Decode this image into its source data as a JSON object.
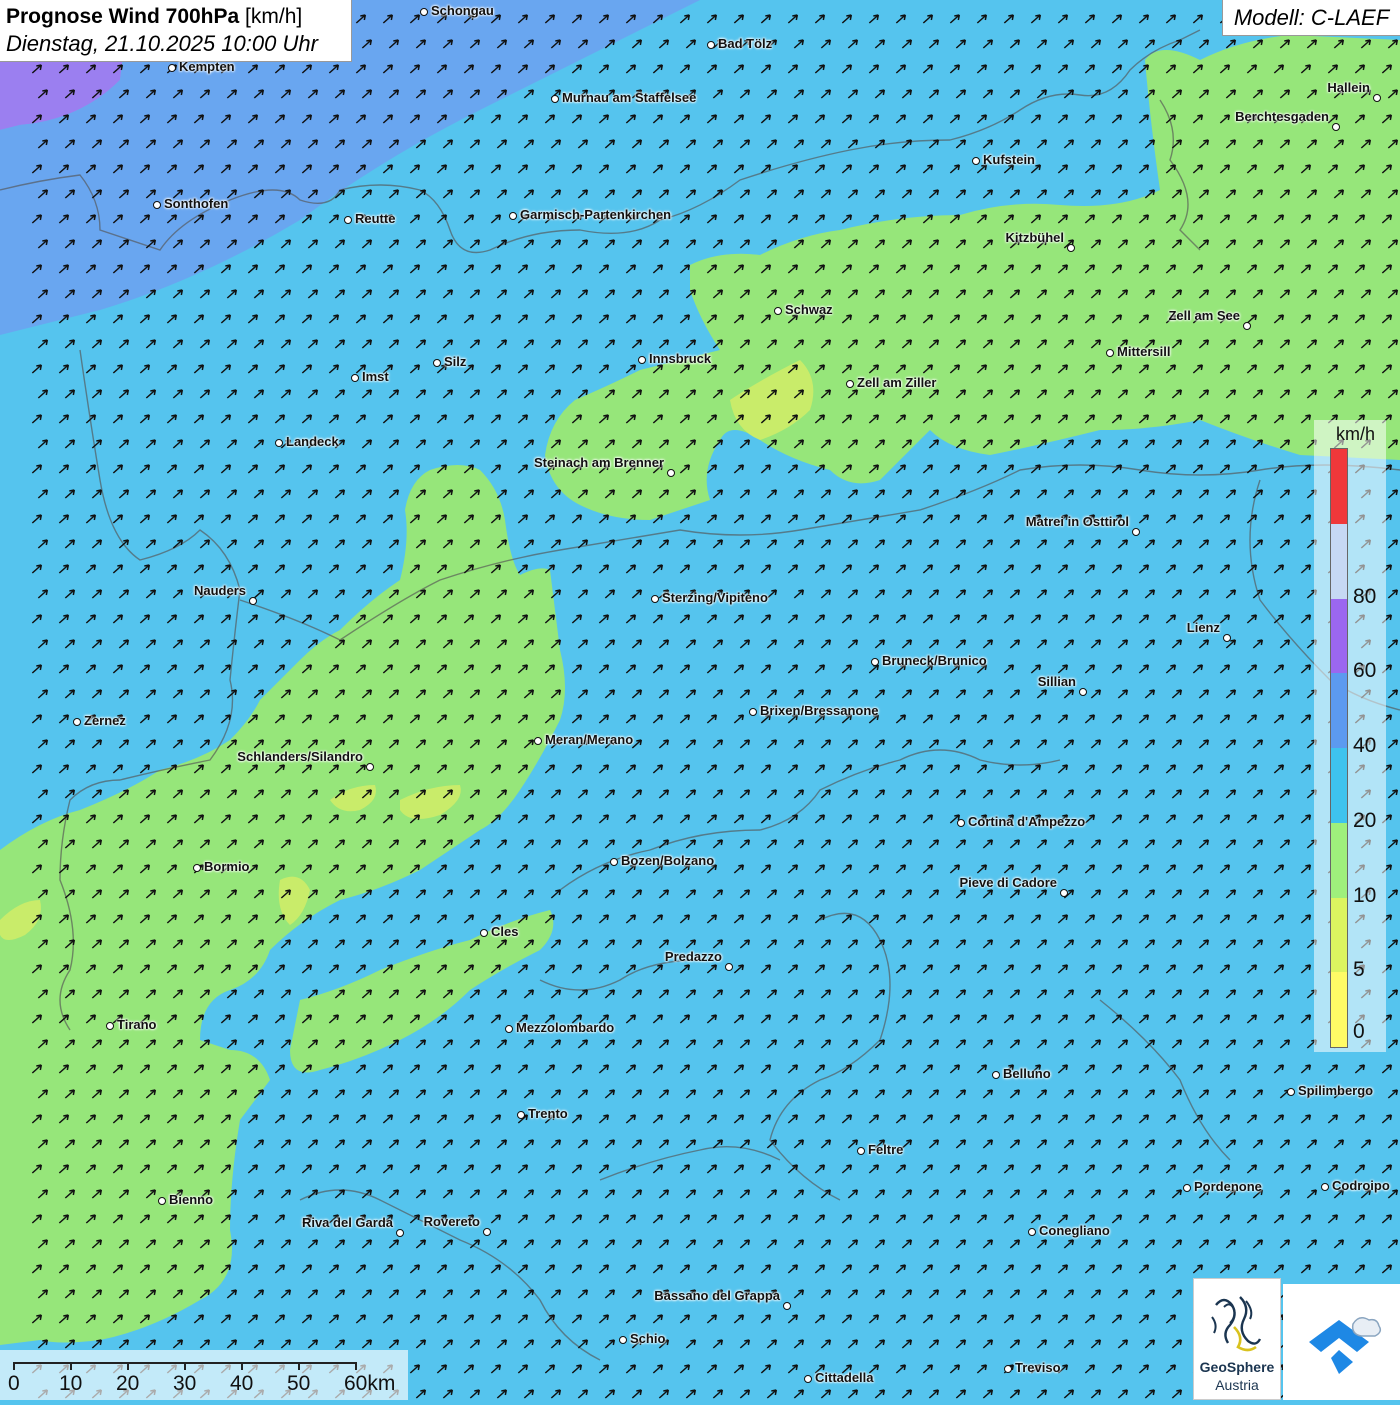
{
  "header": {
    "title_bold": "Prognose Wind 700hPa",
    "title_unit": "[km/h]",
    "datetime": "Dienstag, 21.10.2025 10:00 Uhr",
    "model": "Modell: C-LAEF"
  },
  "colors": {
    "background_blue": "#55c4ee",
    "purple_band": "#9b7ff0",
    "medium_blue": "#6ca3f0",
    "green": "#96e67a",
    "yellow_green": "#c9ec6a",
    "arrow": "#111111",
    "border": "#555555"
  },
  "wind_arrow_icon": "arrow-northeast-icon",
  "cities": [
    {
      "name": "Schongau"
    },
    {
      "name": "Bad Tölz"
    },
    {
      "name": "Kempten"
    },
    {
      "name": "Murnau am Staffelsee"
    },
    {
      "name": "Hallein"
    },
    {
      "name": "Berchtesgaden"
    },
    {
      "name": "Kufstein"
    },
    {
      "name": "Sonthofen"
    },
    {
      "name": "Reutte"
    },
    {
      "name": "Garmisch-Partenkirchen"
    },
    {
      "name": "Kitzbühel"
    },
    {
      "name": "Schwaz"
    },
    {
      "name": "Zell am See"
    },
    {
      "name": "Mittersill"
    },
    {
      "name": "Innsbruck"
    },
    {
      "name": "Silz"
    },
    {
      "name": "Imst"
    },
    {
      "name": "Zell am Ziller"
    },
    {
      "name": "Landeck"
    },
    {
      "name": "Steinach am Brenner"
    },
    {
      "name": "Matrei in Osttirol"
    },
    {
      "name": "Nauders"
    },
    {
      "name": "Sterzing/Vipiteno"
    },
    {
      "name": "Lienz"
    },
    {
      "name": "Bruneck/Brunico"
    },
    {
      "name": "Sillian"
    },
    {
      "name": "Brixen/Bressanone"
    },
    {
      "name": "Zernez"
    },
    {
      "name": "Meran/Merano"
    },
    {
      "name": "Schlanders/Silandro"
    },
    {
      "name": "Cortina d'Ampezzo"
    },
    {
      "name": "Bozen/Bolzano"
    },
    {
      "name": "Bormio"
    },
    {
      "name": "Pieve di Cadore"
    },
    {
      "name": "Cles"
    },
    {
      "name": "Predazzo"
    },
    {
      "name": "Tirano"
    },
    {
      "name": "Mezzolombardo"
    },
    {
      "name": "Belluno"
    },
    {
      "name": "Spilimbergo"
    },
    {
      "name": "Trento"
    },
    {
      "name": "Feltre"
    },
    {
      "name": "Pordenone"
    },
    {
      "name": "Codroipo"
    },
    {
      "name": "Bienno"
    },
    {
      "name": "Riva del Garda"
    },
    {
      "name": "Rovereto"
    },
    {
      "name": "Conegliano"
    },
    {
      "name": "Bassano del Grappa"
    },
    {
      "name": "Schio"
    },
    {
      "name": "Treviso"
    },
    {
      "name": "Cittadella"
    }
  ],
  "legend": {
    "unit": "km/h",
    "segments": [
      {
        "color": "#fffb66"
      },
      {
        "color": "#dcf460"
      },
      {
        "color": "#9ff07c"
      },
      {
        "color": "#3ec3ee"
      },
      {
        "color": "#5c9af0"
      },
      {
        "color": "#9b67f0"
      },
      {
        "color": "#c6d8f4"
      },
      {
        "color": "#f0383a"
      }
    ],
    "ticks": [
      "0",
      "5",
      "10",
      "20",
      "40",
      "60",
      "80"
    ]
  },
  "scale_bar": {
    "labels": [
      "0",
      "10",
      "20",
      "30",
      "40",
      "50",
      "60km"
    ]
  },
  "logos": {
    "geosphere_line1": "GeoSphere",
    "geosphere_line2": "Austria",
    "geosphere_icon": "geosphere-logo-icon",
    "app_icon": "weather-app-logo-icon"
  }
}
